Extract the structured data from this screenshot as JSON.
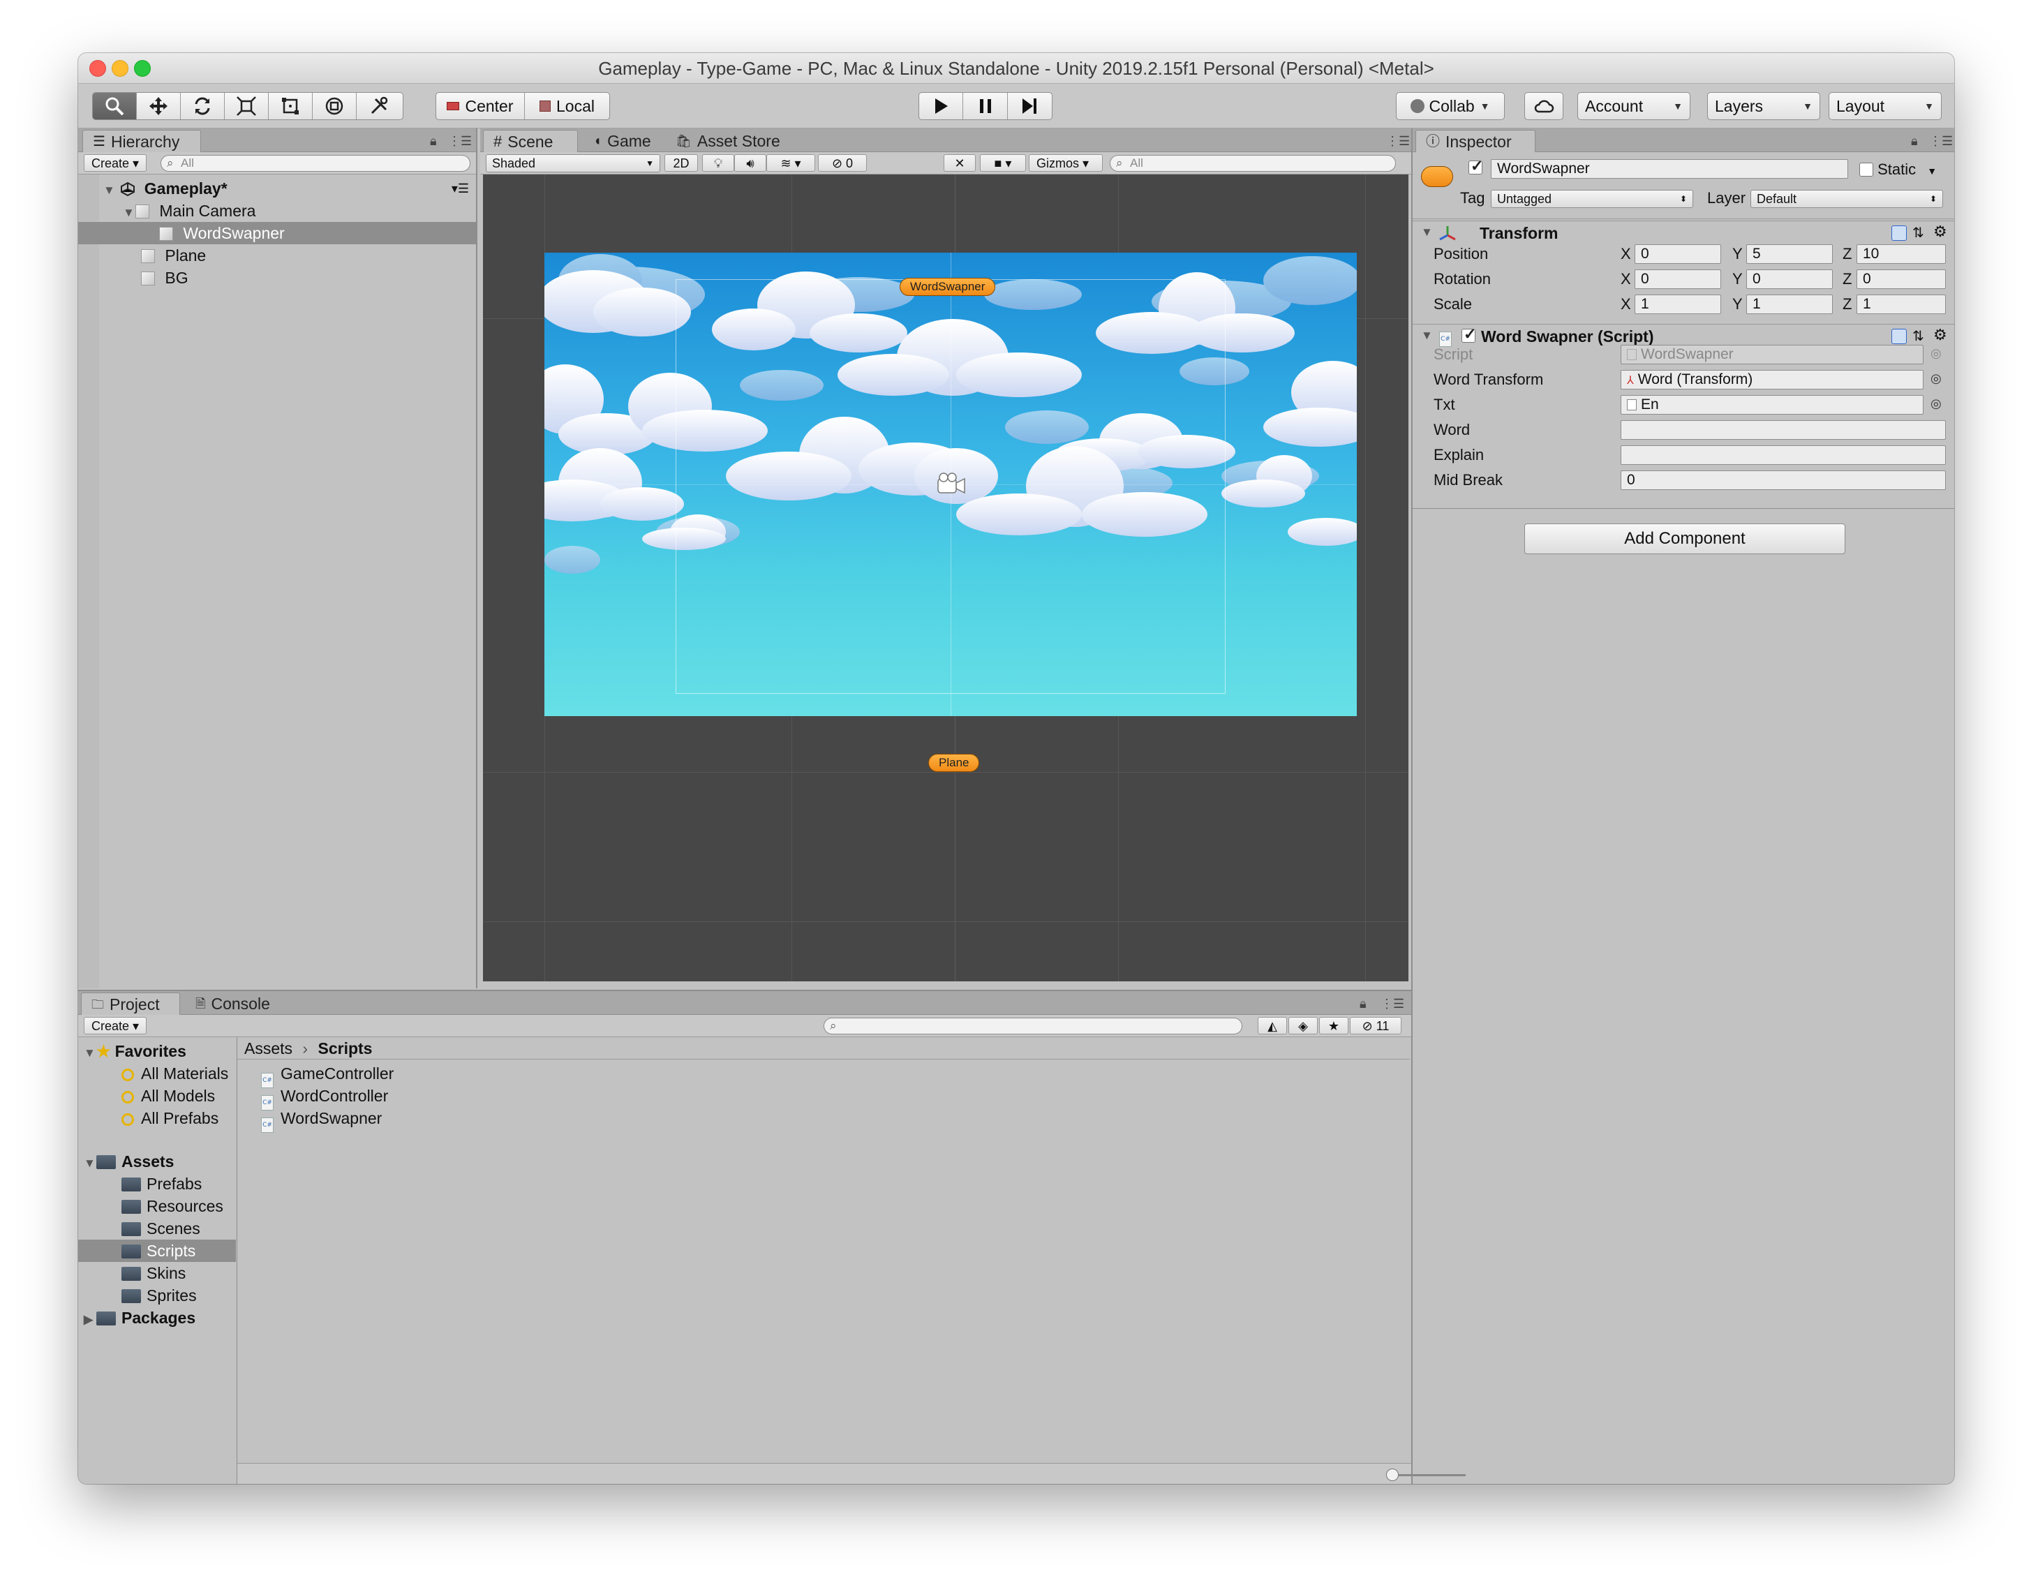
{
  "window": {
    "title": "Gameplay - Type-Game - PC, Mac & Linux Standalone - Unity 2019.2.15f1 Personal (Personal) <Metal>"
  },
  "toolbar": {
    "tools": [
      "hand-tool",
      "move-tool",
      "rotate-tool",
      "scale-tool",
      "rect-tool",
      "transform-tool",
      "custom-tool"
    ],
    "pivot_label": "Center",
    "space_label": "Local",
    "collab_label": "Collab",
    "account_label": "Account",
    "layers_label": "Layers",
    "layout_label": "Layout"
  },
  "hierarchy": {
    "tab": "Hierarchy",
    "create": "Create",
    "search_placeholder": "All",
    "scene": "Gameplay*",
    "items": [
      "Main Camera",
      "WordSwapner",
      "Plane",
      "BG"
    ]
  },
  "scene": {
    "tabs": [
      "Scene",
      "Game",
      "Asset Store"
    ],
    "shading": "Shaded",
    "mode_2d": "2D",
    "hidden_count": "0",
    "gizmos": "Gizmos",
    "search_placeholder": "All",
    "label_wordswapner": "WordSwapner",
    "label_plane": "Plane"
  },
  "inspector": {
    "tab": "Inspector",
    "object_name": "WordSwapner",
    "static_label": "Static",
    "tag_label": "Tag",
    "tag_value": "Untagged",
    "layer_label": "Layer",
    "layer_value": "Default",
    "transform": {
      "title": "Transform",
      "position_label": "Position",
      "rotation_label": "Rotation",
      "scale_label": "Scale",
      "x": "X",
      "y": "Y",
      "z": "Z",
      "position": [
        "0",
        "5",
        "10"
      ],
      "rotation": [
        "0",
        "0",
        "0"
      ],
      "scale": [
        "1",
        "1",
        "1"
      ]
    },
    "script": {
      "title": "Word Swapner (Script)",
      "script_label": "Script",
      "script_value": "WordSwapner",
      "word_transform_label": "Word Transform",
      "word_transform_value": "Word (Transform)",
      "txt_label": "Txt",
      "txt_value": "En",
      "word_label": "Word",
      "word_value": "",
      "explain_label": "Explain",
      "explain_value": "",
      "mid_break_label": "Mid Break",
      "mid_break_value": "0"
    },
    "add_component": "Add Component"
  },
  "project": {
    "tabs": [
      "Project",
      "Console"
    ],
    "create": "Create",
    "hidden_count": "11",
    "favorites_label": "Favorites",
    "favorites": [
      "All Materials",
      "All Models",
      "All Prefabs"
    ],
    "assets_label": "Assets",
    "asset_folders": [
      "Prefabs",
      "Resources",
      "Scenes",
      "Scripts",
      "Skins",
      "Sprites"
    ],
    "packages_label": "Packages",
    "breadcrumb": [
      "Assets",
      "Scripts"
    ],
    "files": [
      "GameController",
      "WordController",
      "WordSwapner"
    ]
  },
  "colors": {
    "accent_orange": "#f08a16",
    "sky_top": "#1a8ad6",
    "sky_bottom": "#67e0e6",
    "selection": "#8e8e8e"
  }
}
